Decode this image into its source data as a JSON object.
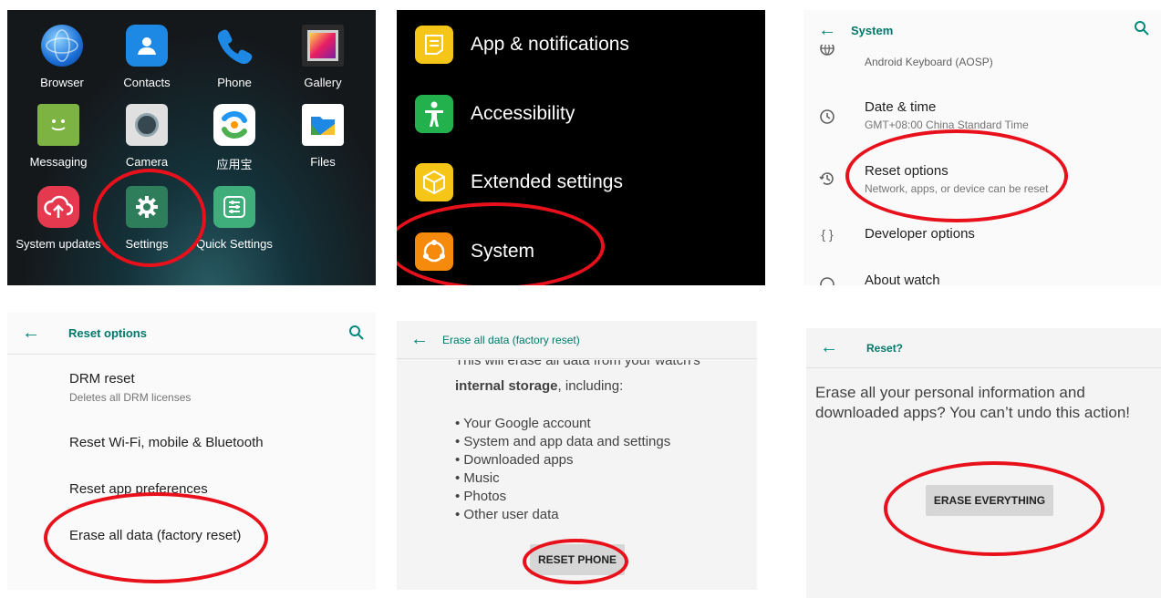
{
  "home": {
    "apps": [
      {
        "label": "Browser",
        "icon": "globe-icon"
      },
      {
        "label": "Contacts",
        "icon": "contacts-icon"
      },
      {
        "label": "Phone",
        "icon": "phone-icon"
      },
      {
        "label": "Gallery",
        "icon": "gallery-icon"
      },
      {
        "label": "Messaging",
        "icon": "message-icon"
      },
      {
        "label": "Camera",
        "icon": "camera-icon"
      },
      {
        "label": "应用宝",
        "icon": "app-store-icon"
      },
      {
        "label": "Files",
        "icon": "files-icon"
      },
      {
        "label": "System updates",
        "icon": "cloud-upload-icon"
      },
      {
        "label": "Settings",
        "icon": "gear-icon"
      },
      {
        "label": "Quick Settings",
        "icon": "sliders-icon"
      }
    ]
  },
  "settings_menu": {
    "items": [
      {
        "label": "App & notifications",
        "color": "#f5c518"
      },
      {
        "label": "Accessibility",
        "color": "#22b14c"
      },
      {
        "label": "Extended settings",
        "color": "#f5c518"
      },
      {
        "label": "System",
        "color": "#f58a0c"
      }
    ]
  },
  "system": {
    "title": "System",
    "items": [
      {
        "title": "",
        "subtitle": "Android Keyboard (AOSP)"
      },
      {
        "title": "Date & time",
        "subtitle": "GMT+08:00 China Standard Time"
      },
      {
        "title": "Reset options",
        "subtitle": "Network, apps, or device can be reset"
      },
      {
        "title": "Developer options",
        "subtitle": ""
      },
      {
        "title": "About watch",
        "subtitle": ""
      }
    ]
  },
  "reset_options": {
    "title": "Reset options",
    "items": [
      {
        "title": "DRM reset",
        "subtitle": "Deletes all DRM licenses"
      },
      {
        "title": "Reset Wi-Fi, mobile & Bluetooth",
        "subtitle": ""
      },
      {
        "title": "Reset app preferences",
        "subtitle": ""
      },
      {
        "title": "Erase all data (factory reset)",
        "subtitle": ""
      }
    ]
  },
  "factory_reset": {
    "title": "Erase all data (factory reset)",
    "intro_cut": "This will erase all data from your watch's",
    "intro_bold": "internal storage",
    "intro_rest": ", including:",
    "bullets": [
      "• Your Google account",
      "• System and app data and settings",
      "• Downloaded apps",
      "• Music",
      "• Photos",
      "• Other user data"
    ],
    "button": "RESET PHONE"
  },
  "confirm": {
    "title": "Reset?",
    "message": "Erase all your personal information and downloaded apps? You can’t undo this action!",
    "button": "ERASE EVERYTHING"
  },
  "accent": "#00897b",
  "highlight": "#e8111b"
}
